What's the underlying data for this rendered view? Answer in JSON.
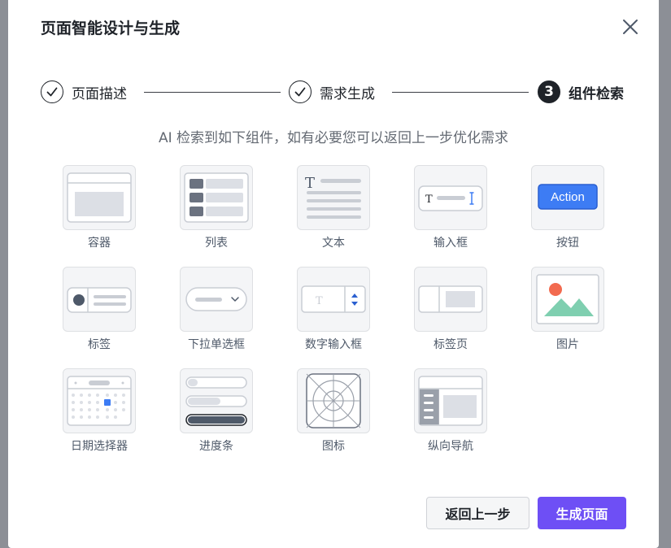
{
  "dialog": {
    "title": "页面智能设计与生成",
    "close_icon": "close-icon"
  },
  "steps": [
    {
      "label": "页面描述",
      "status": "done",
      "icon": "check-icon"
    },
    {
      "label": "需求生成",
      "status": "done",
      "icon": "check-icon"
    },
    {
      "label": "组件检索",
      "status": "current",
      "number": "3"
    }
  ],
  "hint": "AI 检索到如下组件，如有必要您可以返回上一步优化需求",
  "components": [
    {
      "label": "容器",
      "icon": "container-icon"
    },
    {
      "label": "列表",
      "icon": "list-icon"
    },
    {
      "label": "文本",
      "icon": "text-icon"
    },
    {
      "label": "输入框",
      "icon": "input-icon"
    },
    {
      "label": "按钮",
      "icon": "button-icon",
      "preview_text": "Action"
    },
    {
      "label": "标签",
      "icon": "tag-icon"
    },
    {
      "label": "下拉单选框",
      "icon": "select-icon"
    },
    {
      "label": "数字输入框",
      "icon": "number-input-icon"
    },
    {
      "label": "标签页",
      "icon": "tabs-icon"
    },
    {
      "label": "图片",
      "icon": "image-icon"
    },
    {
      "label": "日期选择器",
      "icon": "date-picker-icon"
    },
    {
      "label": "进度条",
      "icon": "progress-icon"
    },
    {
      "label": "图标",
      "icon": "icon-icon"
    },
    {
      "label": "纵向导航",
      "icon": "vertical-nav-icon"
    }
  ],
  "footer": {
    "back_label": "返回上一步",
    "generate_label": "生成页面"
  },
  "colors": {
    "primary": "#6e4ff5",
    "action_blue": "#3d7cf4",
    "icon_gray": "#c9cdd4"
  }
}
